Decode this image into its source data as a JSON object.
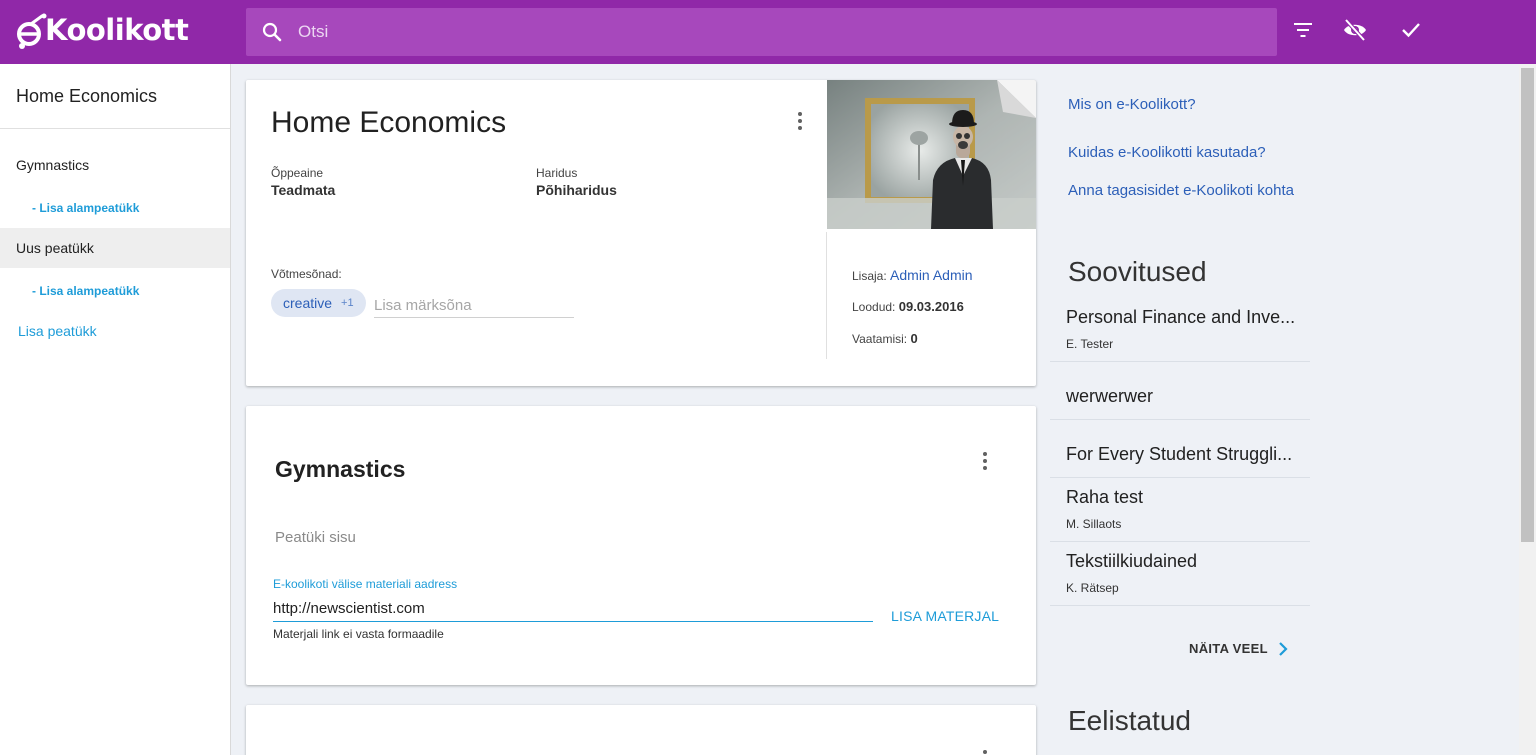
{
  "colors": {
    "brand": "#9028a8",
    "link": "#2c5fb8",
    "accent": "#1e9cd8"
  },
  "app": {
    "logo_text": "Koolikott"
  },
  "search": {
    "placeholder": "Otsi",
    "icon": "search-icon"
  },
  "toolbar": {
    "icons": [
      "filter-icon",
      "visibility-off-icon",
      "check-icon"
    ]
  },
  "sidebar": {
    "title": "Home Economics",
    "chapters": [
      {
        "label": "Gymnastics",
        "sub_action": "- Lisa alampeatükk"
      },
      {
        "label": "Uus peatükk",
        "sub_action": "- Lisa alampeatükk"
      }
    ],
    "add_chapter": "Lisa peatükk"
  },
  "material": {
    "title": "Home Economics",
    "subject_label": "Õppeaine",
    "subject_value": "Teadmata",
    "education_label": "Haridus",
    "education_value": "Põhiharidus",
    "keywords_label": "Võtmesõnad:",
    "keyword_chip": "creative",
    "keyword_more": "+1",
    "keyword_placeholder": "Lisa märksõna",
    "added_by_label": "Lisaja:",
    "added_by_value": "Admin Admin",
    "created_label": "Loodud:",
    "created_value": "09.03.2016",
    "views_label": "Vaatamisi:",
    "views_value": "0"
  },
  "chapter_card": {
    "title": "Gymnastics",
    "content_placeholder": "Peatüki sisu",
    "url_label": "E-koolikoti välise materiali aadress",
    "url_value": "http://newscientist.com",
    "url_help": "Materjali link ei vasta formaadile",
    "add_button": "LISA MATERJAL"
  },
  "help_links": [
    "Mis on e-Koolikott?",
    "Kuidas e-Koolikotti kasutada?",
    "Anna tagasisidet e-Koolikoti kohta"
  ],
  "recommendations": {
    "heading": "Soovitused",
    "items": [
      {
        "title": "Personal Finance and Inve...",
        "author": "E. Tester"
      },
      {
        "title": "werwerwer",
        "author": ""
      },
      {
        "title": "For Every Student Struggli...",
        "author": ""
      },
      {
        "title": "Raha test",
        "author": "M. Sillaots"
      },
      {
        "title": "Tekstiilkiudained",
        "author": "K. Rätsep"
      }
    ],
    "show_more": "NÄITA VEEL"
  },
  "featured": {
    "heading": "Eelistatud"
  }
}
